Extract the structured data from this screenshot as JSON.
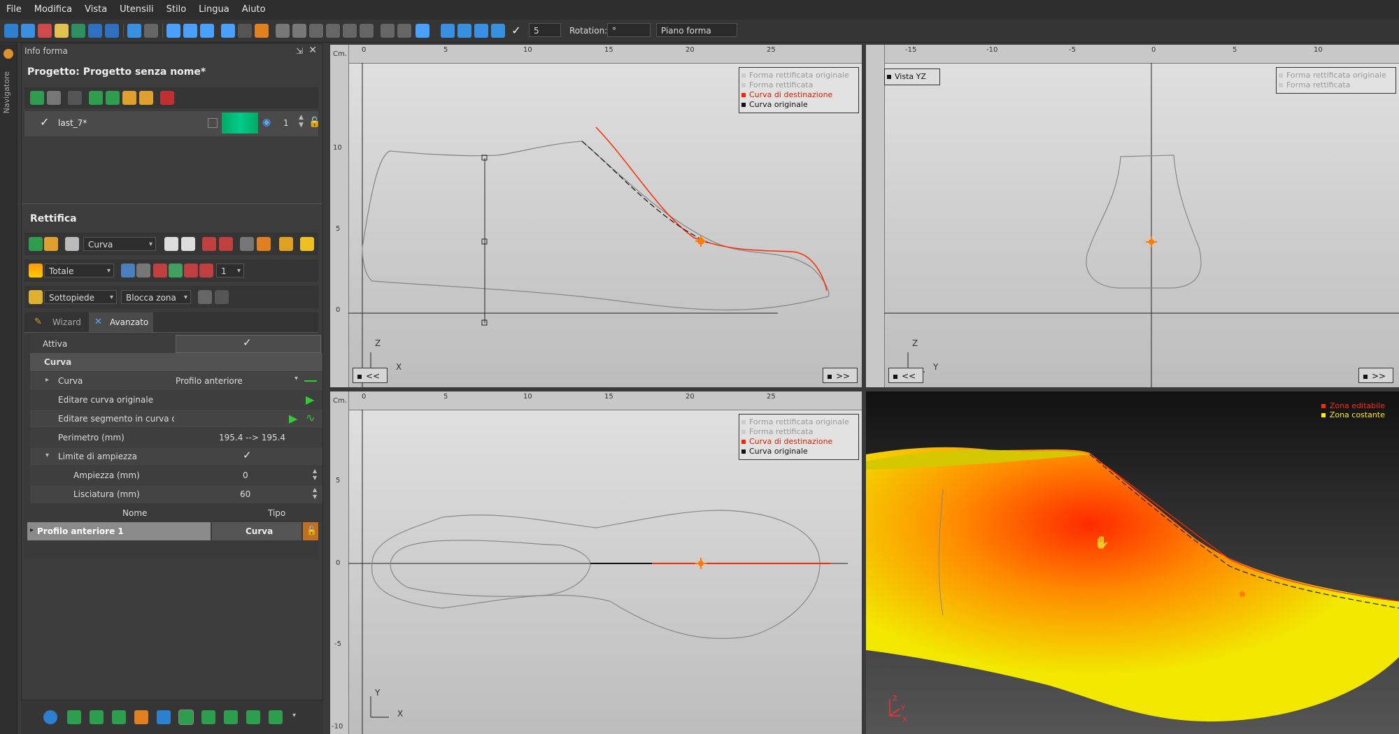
{
  "menubar": [
    "File",
    "Modifica",
    "Vista",
    "Utensili",
    "Stilo",
    "Lingua",
    "Aiuto"
  ],
  "toolbar": {
    "spin_value": "5",
    "rotation_label": "Rotation:",
    "rotation_value": "°",
    "view_select": "Piano forma"
  },
  "navigator_label": "Navigatore",
  "panel": {
    "title": "Info forma",
    "project": "Progetto: Progetto senza nome*",
    "layer": {
      "name": "last_7*",
      "count": "1"
    },
    "rettifica_title": "Rettifica",
    "curva_combo": "Curva",
    "totale_combo": "Totale",
    "totale_spin": "1",
    "sottopiede_combo": "Sottopiede",
    "blocca_combo": "Blocca zona",
    "tabs": [
      "Wizard",
      "Avanzato"
    ],
    "props": {
      "attiva": "Attiva",
      "curva_section": "Curva",
      "curva_name": "Curva",
      "curva_value": "Profilo anteriore",
      "edit_orig": "Editare curva originale",
      "edit_seg": "Editare segmento in curva origin",
      "perimetro": "Perimetro (mm)",
      "perimetro_value": "195.4 --> 195.4",
      "limite": "Limite di ampiezza",
      "ampiezza": "Ampiezza (mm)",
      "ampiezza_value": "0",
      "lisciatura": "Lisciatura (mm)",
      "lisciatura_value": "60"
    },
    "table": {
      "col_nome": "Nome",
      "col_tipo": "Tipo",
      "row_nome": "Profilo anteriore 1",
      "row_tipo": "Curva"
    }
  },
  "viewports": {
    "unit": "Cm.",
    "top_ruler_labels": [
      "0",
      "5",
      "10",
      "15",
      "20",
      "25"
    ],
    "yz_ruler_labels": [
      "-15",
      "-10",
      "-5",
      "0",
      "5",
      "10"
    ],
    "left_labels_top": [
      "10",
      "5",
      "0"
    ],
    "left_labels_bottom": [
      "5",
      "0",
      "-5",
      "-10"
    ],
    "legend_items": [
      "Forma rettificata originale",
      "Forma rettificata",
      "Curva di destinazione",
      "Curva originale"
    ],
    "yz_legend_items": [
      "Forma rettificata originale",
      "Forma rettificata"
    ],
    "vista_yz": "Vista YZ",
    "nav_prev": "<<",
    "nav_next": ">>",
    "axis_z": "Z",
    "axis_x": "X",
    "axis_y": "Y",
    "zone_legend": [
      "Zona editabile",
      "Zona costante"
    ]
  },
  "colors": {
    "accent": "#ff3300",
    "dest_curve": "#ff2200",
    "orig_curve": "#111111",
    "zone_edit": "#ff2a00",
    "zone_const": "#ffee00"
  }
}
